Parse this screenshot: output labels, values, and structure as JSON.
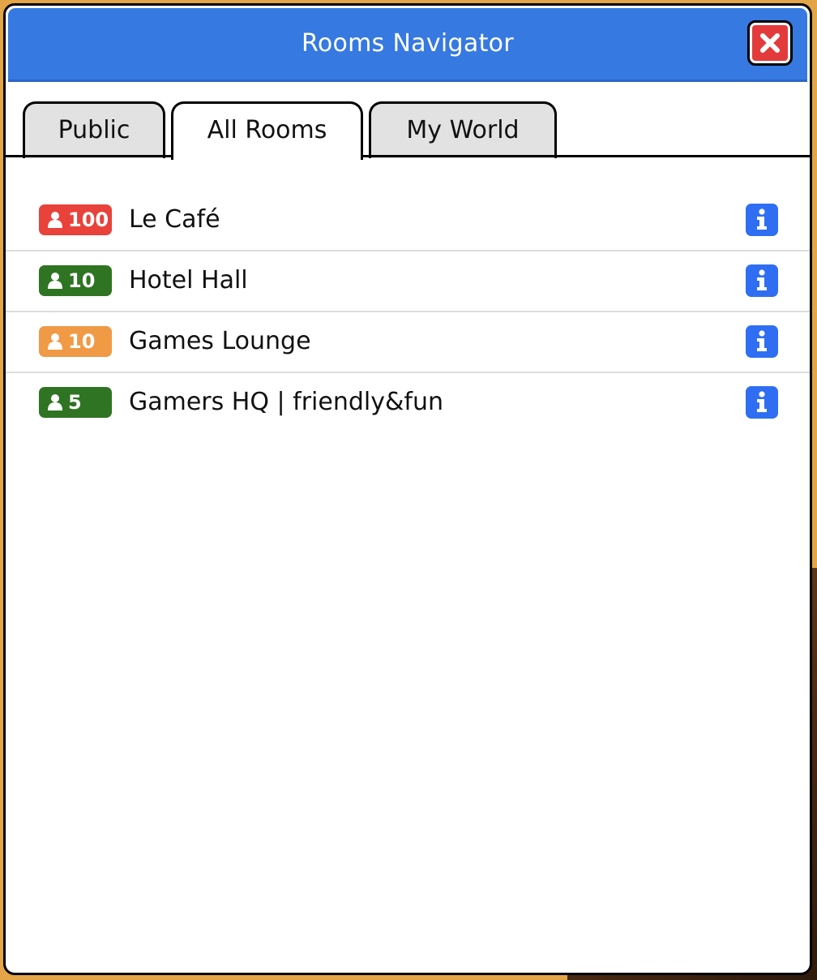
{
  "window": {
    "title": "Rooms Navigator"
  },
  "tabs": [
    {
      "label": "Public",
      "active": false
    },
    {
      "label": "All Rooms",
      "active": true
    },
    {
      "label": "My World",
      "active": false
    }
  ],
  "rooms": [
    {
      "count": "100",
      "name": "Le Café",
      "badge_color": "#e8423b"
    },
    {
      "count": "10",
      "name": "Hotel Hall",
      "badge_color": "#2f7423"
    },
    {
      "count": "10",
      "name": "Games Lounge",
      "badge_color": "#f09a45"
    },
    {
      "count": "5",
      "name": "Gamers HQ | friendly&fun",
      "badge_color": "#2f7423"
    }
  ],
  "colors": {
    "titlebar": "#3679e0",
    "close_button": "#e33b3b",
    "info_button": "#2f6ef2",
    "backdrop": "#e3a547"
  },
  "icons": {
    "close": "close-icon",
    "info": "info-icon",
    "user": "person-icon"
  }
}
